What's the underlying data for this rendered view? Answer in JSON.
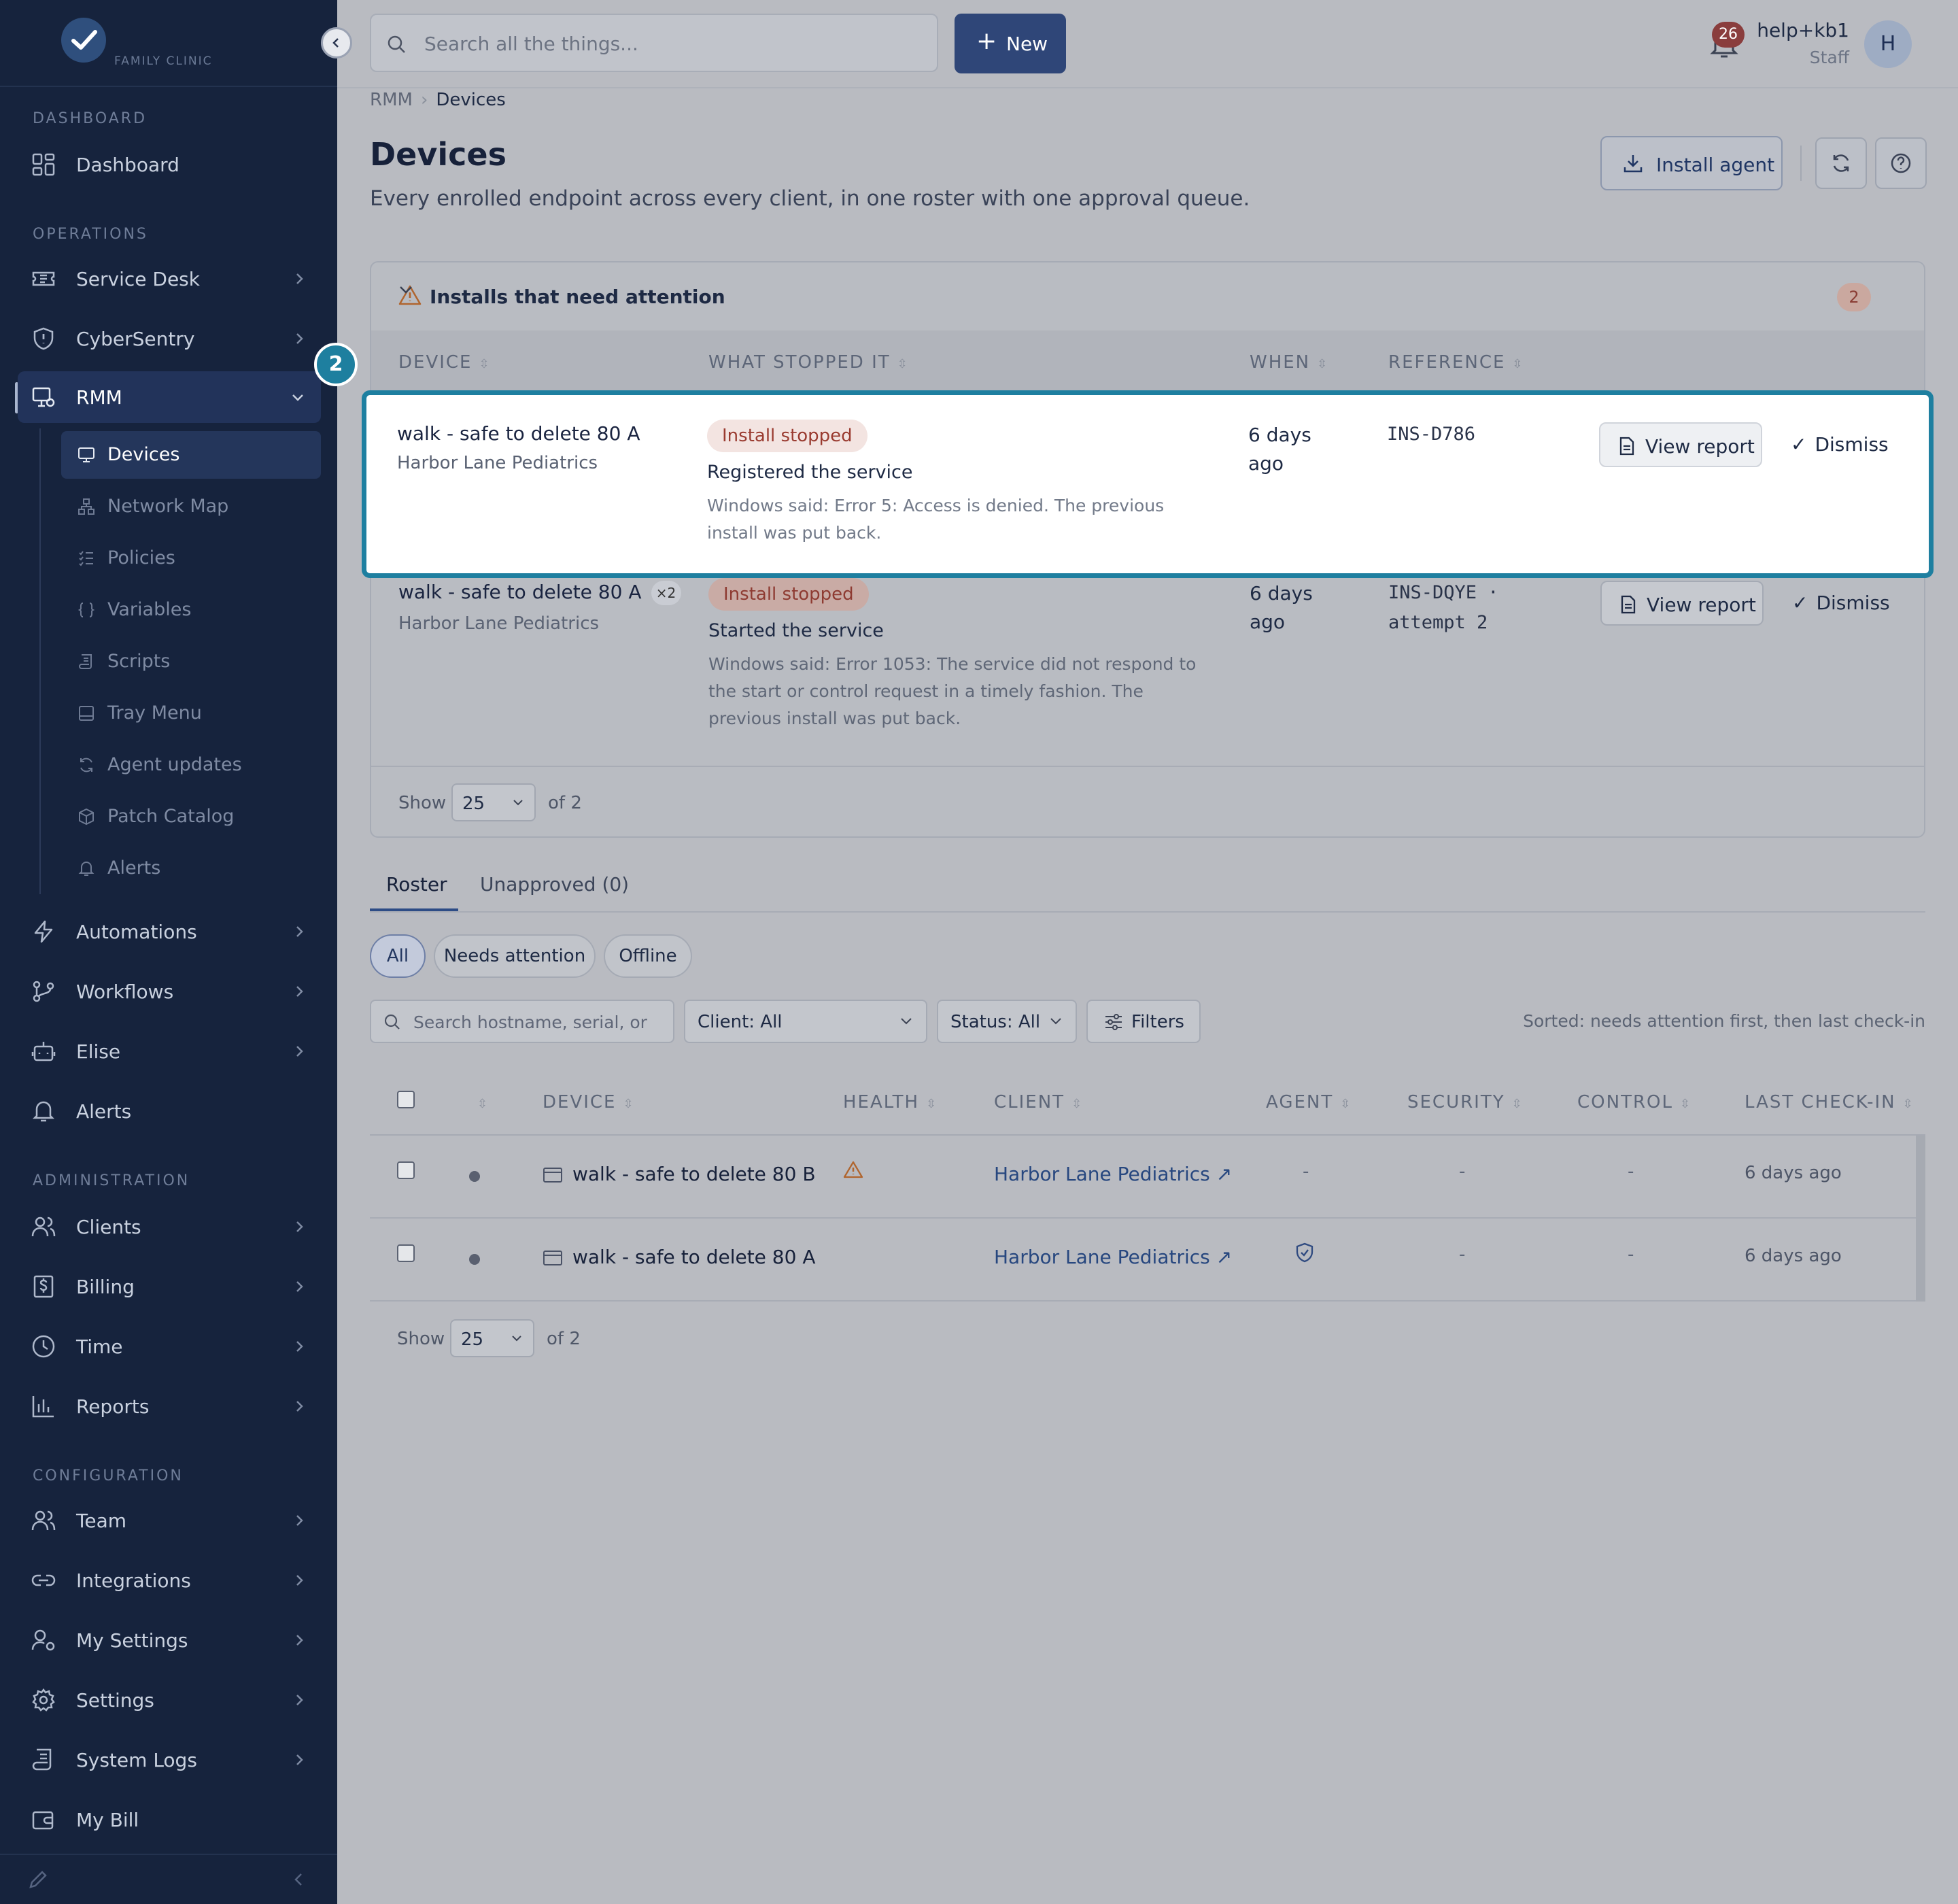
{
  "brand": {
    "name": "FAMILY CLINIC"
  },
  "sidebar": {
    "sections": [
      "DASHBOARD",
      "OPERATIONS",
      "ADMINISTRATION",
      "CONFIGURATION"
    ],
    "dashboard": "Dashboard",
    "operations": [
      "Service Desk",
      "CyberSentry",
      "RMM"
    ],
    "rmm_sub": [
      "Devices",
      "Network Map",
      "Policies",
      "Variables",
      "Scripts",
      "Tray Menu",
      "Agent updates",
      "Patch Catalog",
      "Alerts"
    ],
    "operations_more": [
      "Automations",
      "Workflows",
      "Elise",
      "Alerts"
    ],
    "administration": [
      "Clients",
      "Billing",
      "Time",
      "Reports"
    ],
    "configuration": [
      "Team",
      "Integrations",
      "My Settings",
      "Settings",
      "System Logs",
      "My Bill"
    ]
  },
  "topbar": {
    "search_placeholder": "Search all the things...",
    "new_label": "New",
    "notif_count": "26",
    "user_name": "help+kb1",
    "user_role": "Staff",
    "avatar_initial": "H"
  },
  "breadcrumb": {
    "parent": "RMM",
    "current": "Devices"
  },
  "page": {
    "title": "Devices",
    "subtitle": "Every enrolled endpoint across every client, in one roster with one approval queue.",
    "install_label": "Install agent"
  },
  "attention": {
    "title": "Installs that need attention",
    "count": "2",
    "columns": [
      "DEVICE",
      "WHAT STOPPED IT",
      "WHEN",
      "REFERENCE"
    ],
    "rows": [
      {
        "device": "walk - safe to delete 80 A",
        "client": "Harbor Lane Pediatrics",
        "status": "Install stopped",
        "step": "Registered the service",
        "error": "Windows said: Error 5: Access is denied. The previous install was put back.",
        "when": "6 days ago",
        "reference": "INS-D786",
        "view": "View report",
        "dismiss": "Dismiss"
      },
      {
        "device": "walk - safe to delete 80 A",
        "multiplier": "×2",
        "client": "Harbor Lane Pediatrics",
        "status": "Install stopped",
        "step": "Started the service",
        "error": "Windows said: Error 1053: The service did not respond to the start or control request in a timely fashion. The previous install was put back.",
        "when": "6 days ago",
        "reference": "INS-DQYE · attempt 2",
        "view": "View report",
        "dismiss": "Dismiss"
      }
    ],
    "show_label": "Show",
    "page_size": "25",
    "of_label": "of 2"
  },
  "step_marker": "2",
  "tabs": [
    "Roster",
    "Unapproved (0)"
  ],
  "chips": [
    "All",
    "Needs attention",
    "Offline"
  ],
  "roster": {
    "search_placeholder": "Search hostname, serial, or",
    "client_filter": "Client: All",
    "status_filter": "Status: All",
    "filters_label": "Filters",
    "sorted_note": "Sorted: needs attention first, then last check-in",
    "columns": [
      "DEVICE",
      "HEALTH",
      "CLIENT",
      "AGENT",
      "SECURITY",
      "CONTROL",
      "LAST CHECK-IN"
    ],
    "rows": [
      {
        "device": "walk - safe to delete 80 B",
        "client": "Harbor Lane Pediatrics ↗",
        "agent": "-",
        "security": "-",
        "control": "-",
        "last_checkin": "6 days ago"
      },
      {
        "device": "walk - safe to delete 80 A",
        "client": "Harbor Lane Pediatrics ↗",
        "security": "-",
        "control": "-",
        "last_checkin": "6 days ago"
      }
    ],
    "show_label": "Show",
    "page_size": "25",
    "of_label": "of 2"
  }
}
